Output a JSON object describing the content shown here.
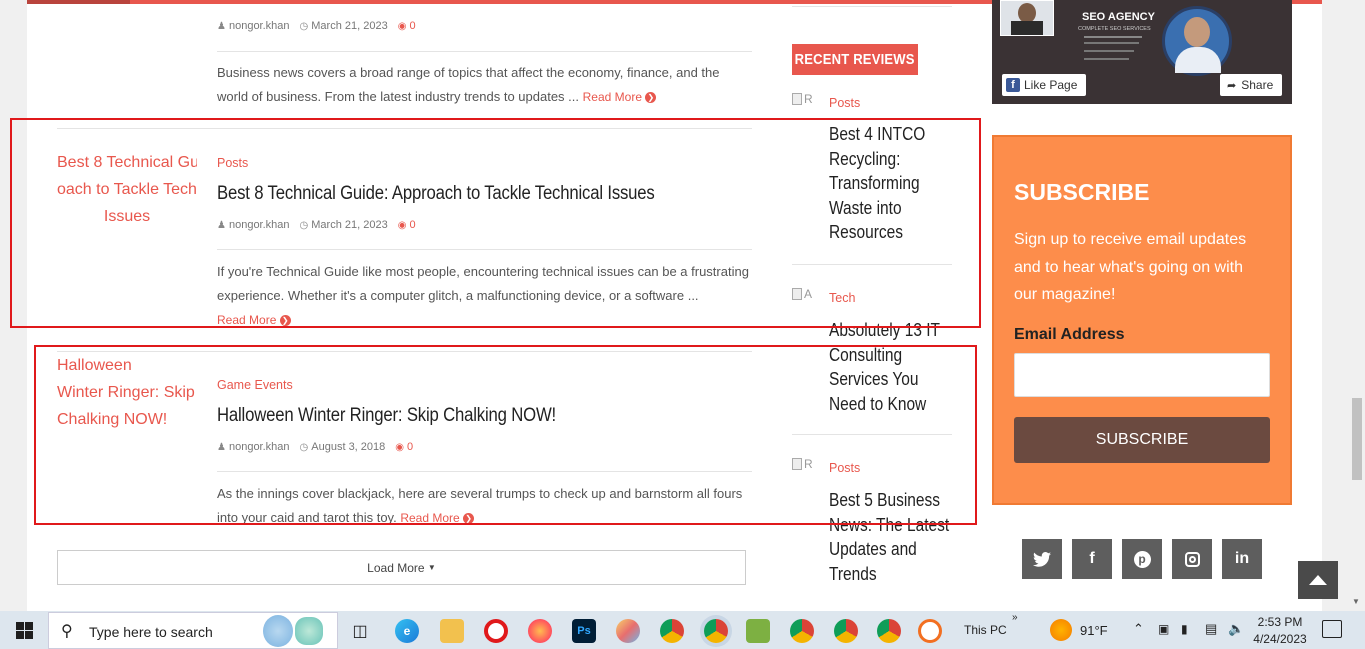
{
  "articles": [
    {
      "author": "nongor.khan",
      "date": "March 21, 2023",
      "comments": "0",
      "excerpt": "Business news covers a broad range of topics that affect the economy, finance, and the world of business. From the latest industry trends to updates ...",
      "read_more": "Read More"
    },
    {
      "thumb_alt_lines": [
        "Best 8 Technical Gui",
        "oach to Tackle Tech",
        "Issues"
      ],
      "category": "Posts",
      "title": "Best 8 Technical Guide: Approach to Tackle Technical Issues",
      "author": "nongor.khan",
      "date": "March 21, 2023",
      "comments": "0",
      "excerpt": "If you're Technical Guide like most people, encountering technical issues can be a frustrating experience. Whether it's a computer glitch, a malfunctioning device, or a software ...",
      "read_more": "Read More"
    },
    {
      "thumb_alt_lines": [
        "Halloween",
        "Winter Ringer: Skip",
        "Chalking NOW!"
      ],
      "category": "Game Events",
      "title": "Halloween Winter Ringer: Skip Chalking NOW!",
      "author": "nongor.khan",
      "date": "August 3, 2018",
      "comments": "0",
      "excerpt": "As the innings cover blackjack, here are several trumps to check up and barnstorm all fours into your caid and tarot this toy.",
      "read_more": "Read More"
    }
  ],
  "load_more": "Load More",
  "recent_reviews": {
    "heading": "RECENT REVIEWS",
    "items": [
      {
        "img_alt": "R",
        "category": "Posts",
        "title": "Best 4 INTCO Recycling: Transforming Waste into Resources"
      },
      {
        "img_alt": "A",
        "category": "Tech",
        "title": "Absolutely 13 IT Consulting Services You Need to Know"
      },
      {
        "img_alt": "R",
        "category": "Posts",
        "title": "Best 5 Business News: The Latest Updates and Trends"
      }
    ]
  },
  "fb_widget": {
    "agency_title": "SEO AGENCY",
    "agency_sub": "COMPLETE SEO SERVICES",
    "like_label": "Like Page",
    "share_label": "Share"
  },
  "subscribe": {
    "heading": "SUBSCRIBE",
    "text": "Sign up to receive email updates and to hear what's going on with our magazine!",
    "email_label": "Email Address",
    "email_value": "",
    "button_label": "SUBSCRIBE"
  },
  "social_icons": [
    "twitter-icon",
    "facebook-icon",
    "pinterest-icon",
    "instagram-icon",
    "linkedin-icon"
  ],
  "taskbar": {
    "search_placeholder": "Type here to search",
    "this_pc": "This PC",
    "weather": "91°F",
    "time": "2:53 PM",
    "date": "4/24/2023"
  },
  "colors": {
    "accent": "#e8574d",
    "subscribe_bg": "#fd8d4b",
    "subscribe_button": "#6b4a40",
    "annotation": "#e0191b"
  }
}
